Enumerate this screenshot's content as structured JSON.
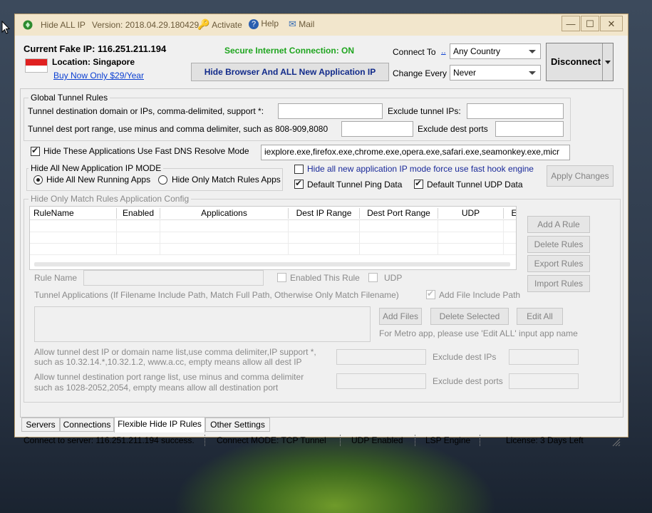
{
  "window": {
    "title": "Hide ALL IP",
    "version": "Version: 2018.04.29.180429",
    "activate": "Activate",
    "help": "Help",
    "mail": "Mail"
  },
  "header": {
    "current_ip_label": "Current Fake IP: 116.251.211.194",
    "location": "Location: Singapore",
    "buy_link": "Buy Now Only $29/Year",
    "secure_status": "Secure Internet Connection: ON",
    "hide_browser_button": "Hide Browser And ALL New Application IP",
    "connect_to_label": "Connect To",
    "connect_to_link": "..",
    "connect_to_value": "Any Country",
    "change_every_label": "Change Every",
    "change_every_value": "Never",
    "disconnect_button": "Disconnect"
  },
  "global_rules": {
    "title": "Global Tunnel Rules",
    "domain_label": "Tunnel destination domain or IPs, comma-delimited, support *:",
    "exclude_ips_label": "Exclude tunnel IPs:",
    "port_label": "Tunnel dest port range, use minus and comma delimiter, such as 808-909,8080",
    "exclude_ports_label": "Exclude dest ports"
  },
  "dns": {
    "label": "Hide These Applications Use Fast DNS Resolve Mode",
    "apps_value": "iexplore.exe,firefox.exe,chrome.exe,opera.exe,safari.exe,seamonkey.exe,micr"
  },
  "new_app_mode": {
    "title": "Hide All New Application IP MODE",
    "option_all": "Hide All New Running Apps",
    "option_match": "Hide Only Match Rules Apps",
    "force_hook": "Hide all new application IP mode force use fast hook engine",
    "ping_data": "Default Tunnel Ping Data",
    "udp_data": "Default Tunnel UDP Data",
    "apply_button": "Apply Changes"
  },
  "match_rules": {
    "title": "Hide Only Match Rules Application Config",
    "columns": [
      "RuleName",
      "Enabled",
      "Applications",
      "Dest IP Range",
      "Dest Port Range",
      "UDP",
      "E"
    ],
    "add_rule": "Add A Rule",
    "delete_rules": "Delete Rules",
    "export_rules": "Export Rules",
    "import_rules": "Import Rules",
    "rule_name_label": "Rule Name",
    "enabled_rule": "Enabled This Rule",
    "udp": "UDP",
    "tunnel_apps_label": "Tunnel Applications (If Filename Include Path, Match Full Path, Otherwise Only Match Filename)",
    "add_file_path": "Add File Include Path",
    "add_files": "Add Files",
    "delete_selected": "Delete Selected",
    "edit_all": "Edit All",
    "metro_note": "For Metro app, please use 'Edit ALL' input app name",
    "allow_ip_line1": "Allow tunnel dest IP or domain name list,use comma delimiter,IP support *,",
    "allow_ip_line2": "such as 10.32.14.*,10.32.1.2, www.a.cc, empty means allow all dest IP",
    "exclude_dest_ips": "Exclude dest IPs",
    "allow_port_line1": "Allow tunnel destination port range list, use minus and comma delimiter",
    "allow_port_line2": "such as 1028-2052,2054, empty means allow all destination port",
    "exclude_dest_ports": "Exclude dest ports"
  },
  "tabs": [
    "Servers",
    "Connections",
    "Flexible Hide IP Rules",
    "Other Settings"
  ],
  "status": {
    "connect": "Connect to server: 116.251.211.194 success.",
    "mode": "Connect MODE: TCP Tunnel",
    "udp": "UDP Enabled",
    "lsp": "LSP Engine",
    "license": "License: 3 Days Left"
  },
  "colors": {
    "secure_green": "#1fa51f",
    "link_blue": "#0b3fd1",
    "title_bg": "#f2e6cc"
  }
}
